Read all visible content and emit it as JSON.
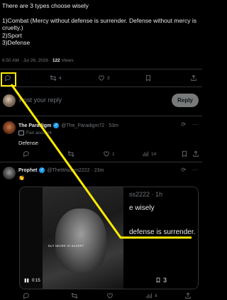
{
  "post": {
    "line1": "There are 3 types choose wisely",
    "body": "1)Combat (Mercy without defense is surrender. Defense without mercy is cruelty.)\n2)Sport\n3)Defense",
    "timestamp": "6:50 AM · Jul 26, 2026 · ",
    "views_count": "122",
    "views_label": "Views",
    "retweets": "4",
    "likes": "3"
  },
  "reply": {
    "placeholder": "Post your reply",
    "button": "Reply"
  },
  "comments": [
    {
      "name": "The Paradigm",
      "handle": "@The_Paradigm72 · 53m",
      "badge": "Fan account",
      "text": "Defense",
      "likes": "1",
      "views": "14"
    },
    {
      "name": "Prophet",
      "handle": "@TheWisdom2222 · 23m",
      "emoji": "👏",
      "media": {
        "handle_fragment": "ss2222 · 1h",
        "line1": "e wisely",
        "line2": "defense is surrender. I",
        "caption": "BUT NEVER TO ACCEPT",
        "time": "0:15",
        "count": "3"
      },
      "likes": "4"
    }
  ],
  "colors": {
    "highlight": "#ffeb00",
    "accent": "#1d9bf0"
  }
}
